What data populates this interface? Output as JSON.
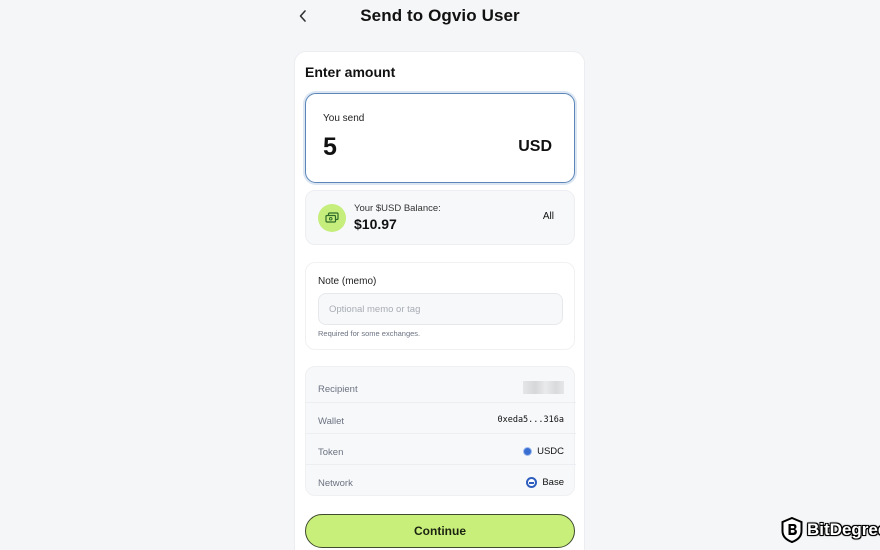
{
  "header": {
    "title": "Send to Ogvio User"
  },
  "form": {
    "heading": "Enter amount",
    "you_send_label": "You send",
    "amount": "5",
    "currency": "USD"
  },
  "balance": {
    "label": "Your $USD Balance:",
    "value": "$10.97",
    "all_label": "All"
  },
  "memo": {
    "label": "Note (memo)",
    "placeholder": "Optional memo or tag",
    "hint": "Required for some exchanges."
  },
  "details": {
    "recipient_label": "Recipient",
    "wallet_label": "Wallet",
    "wallet_value": "0xeda5...316a",
    "token_label": "Token",
    "token_value": "USDC",
    "network_label": "Network",
    "network_value": "Base"
  },
  "actions": {
    "continue_label": "Continue"
  },
  "watermark": {
    "text": "BitDegree"
  },
  "colors": {
    "accent": "#c8ef7a",
    "focus_border": "#5d86b8"
  },
  "icons": {
    "back": "chevron-left-icon",
    "wallet": "wallet-icon",
    "token": "usdc-icon",
    "network": "base-network-icon"
  }
}
